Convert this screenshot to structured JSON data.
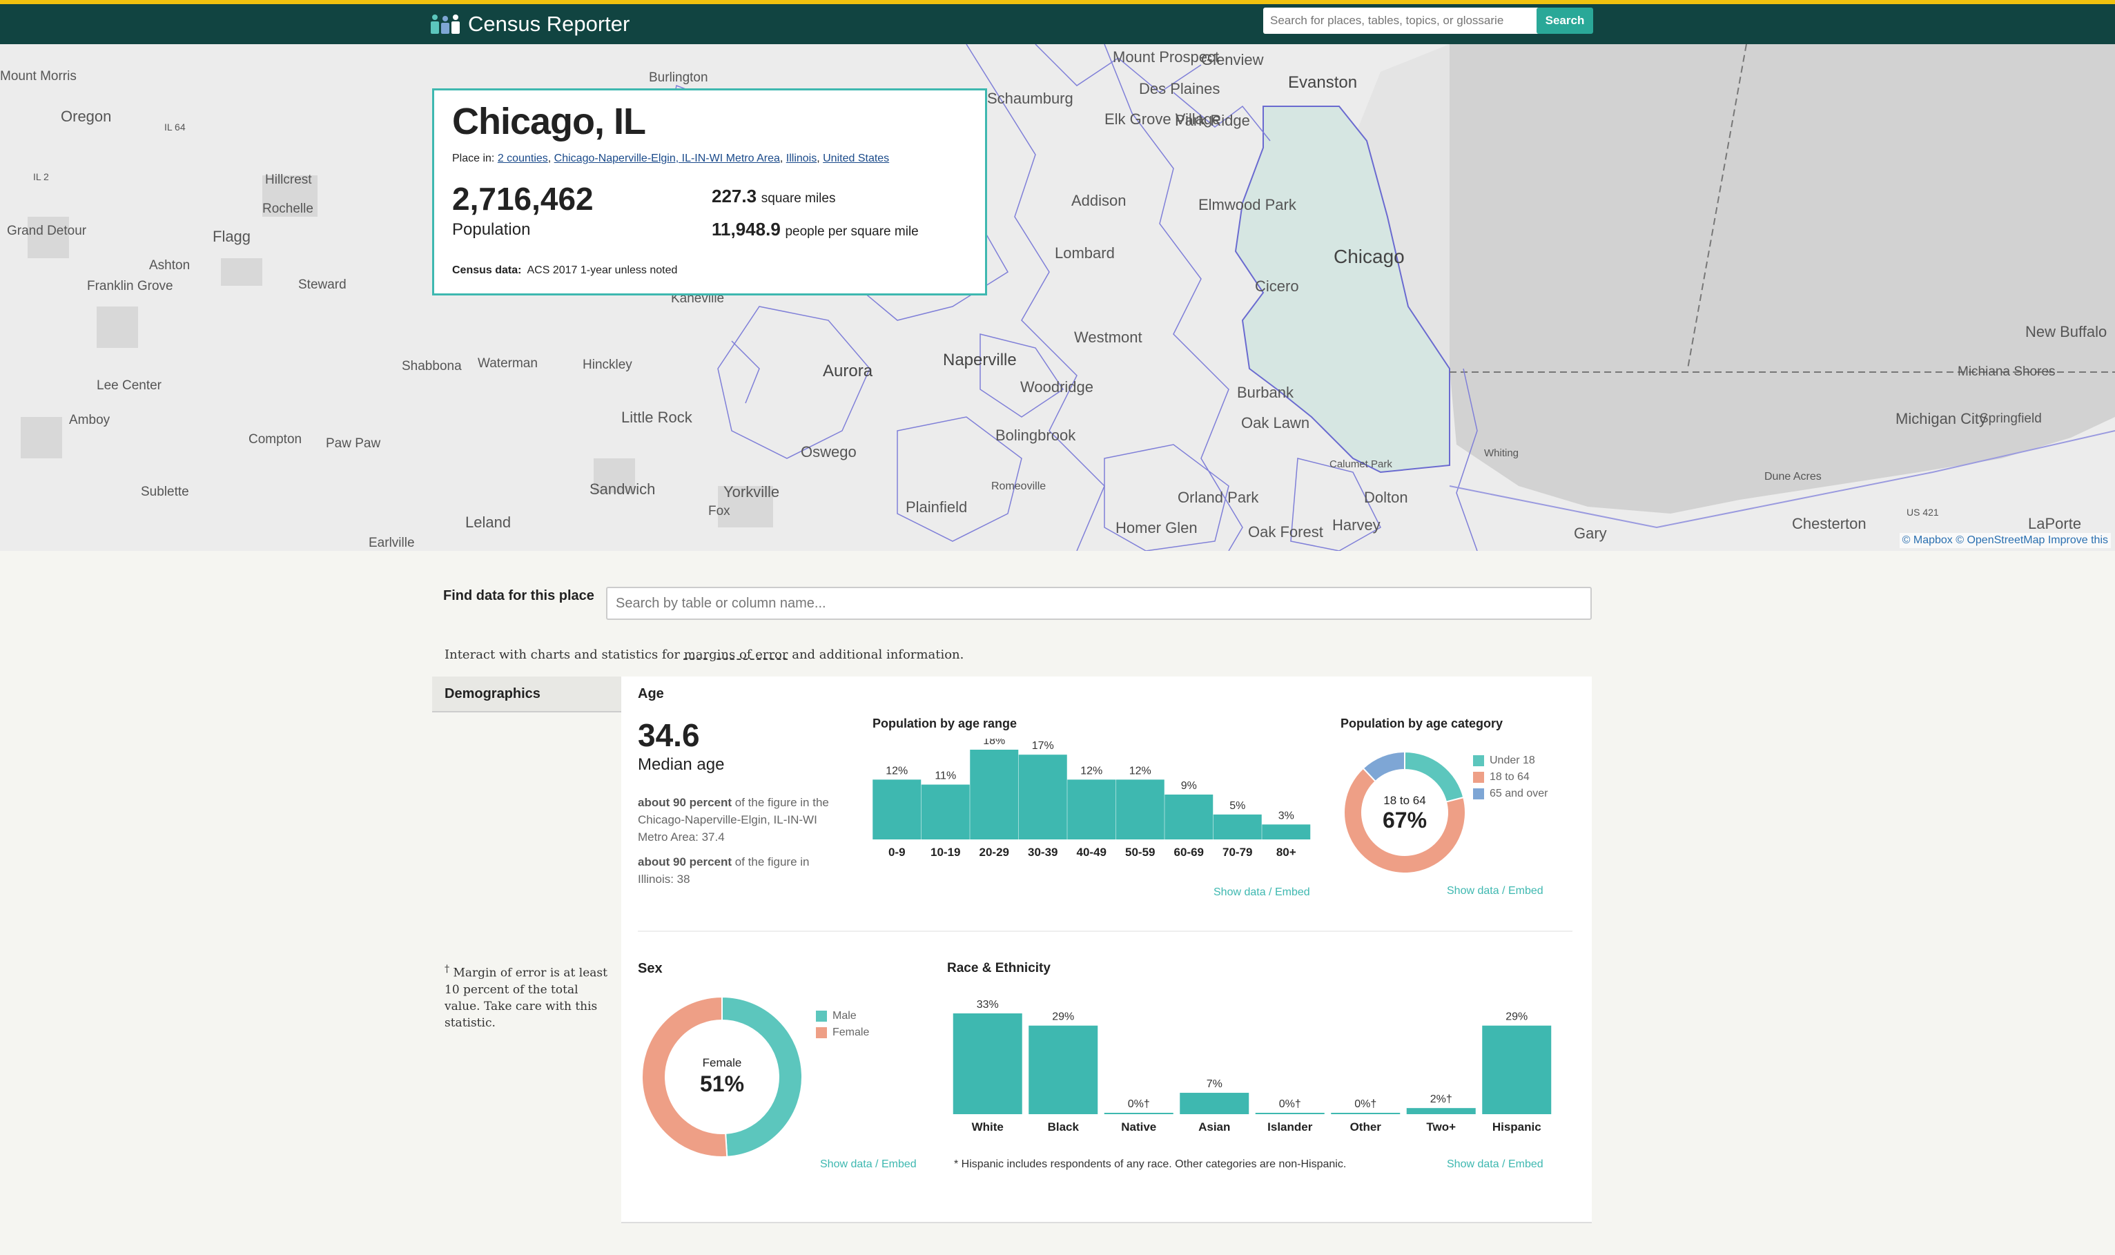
{
  "header": {
    "app_name": "Census Reporter",
    "search_placeholder": "Search for places, tables, topics, or glossarie",
    "search_button": "Search"
  },
  "map": {
    "labels": [
      "Mount Prospect",
      "Glenview",
      "Evanston",
      "Des Plaines",
      "Schaumburg",
      "Burlington",
      "Elk Grove Village",
      "Park Ridge",
      "Oregon",
      "IL 64",
      "IL 2",
      "Hillcrest",
      "Rochelle",
      "Grand Detour",
      "Flagg",
      "Ashton",
      "Steward",
      "Franklin Grove",
      "Addison",
      "Elmwood Park",
      "Chicago",
      "Lombard",
      "Cicero",
      "Kaneville",
      "Westmont",
      "New Buffalo",
      "Shabbona",
      "Waterman",
      "Hinckley",
      "Aurora",
      "Naperville",
      "Woodridge",
      "Michiana Shores",
      "Lee Center",
      "Amboy",
      "Little Rock",
      "Burbank",
      "Oak Lawn",
      "Michigan City",
      "Springfield",
      "Compton",
      "Paw Paw",
      "Oswego",
      "Bolingbrook",
      "Whiting",
      "Calumet Park",
      "Sublette",
      "Sandwich",
      "Yorkville",
      "Romeoville",
      "Orland Park",
      "Dolton",
      "Dune Acres",
      "Plainfield",
      "Fox",
      "Homer Glen",
      "Leland",
      "Harvey",
      "Oak Forest",
      "Chesterton",
      "US 421",
      "LaPorte",
      "Gary",
      "Earlville",
      "Mount Morris"
    ],
    "attribution": "© Mapbox © OpenStreetMap Improve this"
  },
  "place": {
    "name": "Chicago, IL",
    "place_in_label": "Place in:",
    "place_in": [
      "2 counties",
      "Chicago-Naperville-Elgin, IL-IN-WI Metro Area",
      "Illinois",
      "United States"
    ],
    "population": "2,716,462",
    "population_label": "Population",
    "area": "227.3",
    "area_label": "square miles",
    "density": "11,948.9",
    "density_label": "people per square mile",
    "census_label": "Census data:",
    "census_value": "ACS 2017 1-year unless noted"
  },
  "find": {
    "label": "Find data for this place",
    "placeholder": "Search by table or column name..."
  },
  "interact": {
    "prefix": "Interact with charts and statistics for ",
    "link": "margins of error",
    "suffix": " and additional information."
  },
  "sidebar": {
    "tab": "Demographics",
    "moe_mark": "†",
    "moe_note": "Margin of error is at least 10 percent of the total value. Take care with this statistic."
  },
  "age": {
    "title": "Age",
    "median": "34.6",
    "median_label": "Median age",
    "note1_bold": "about 90 percent",
    "note1": " of the figure in the Chicago-Naperville-Elgin, IL-IN-WI Metro Area: 37.4",
    "note2_bold": "about 90 percent",
    "note2": " of the figure in Illinois: 38",
    "range_title": "Population by age range",
    "category_title": "Population by age category",
    "donut_label": "18 to 64",
    "donut_value": "67%",
    "show_data": "Show data",
    "embed": "Embed"
  },
  "sex": {
    "title": "Sex",
    "donut_label": "Female",
    "donut_value": "51%"
  },
  "race": {
    "title": "Race & Ethnicity",
    "footnote": "* Hispanic includes respondents of any race. Other categories are non-Hispanic."
  },
  "chart_data": [
    {
      "type": "bar",
      "title": "Population by age range",
      "categories": [
        "0-9",
        "10-19",
        "20-29",
        "30-39",
        "40-49",
        "50-59",
        "60-69",
        "70-79",
        "80+"
      ],
      "values": [
        12,
        11,
        18,
        17,
        12,
        12,
        9,
        5,
        3
      ],
      "labels": [
        "12%",
        "11%",
        "18%",
        "17%",
        "12%",
        "12%",
        "9%",
        "5%",
        "3%"
      ],
      "color": "#3eb8b0"
    },
    {
      "type": "pie",
      "title": "Population by age category",
      "categories": [
        "Under 18",
        "18 to 64",
        "65 and over"
      ],
      "values": [
        21,
        67,
        12
      ],
      "colors": [
        "#5cc6bd",
        "#ee9f86",
        "#7ea6d5"
      ]
    },
    {
      "type": "pie",
      "title": "Sex",
      "categories": [
        "Male",
        "Female"
      ],
      "values": [
        49,
        51
      ],
      "colors": [
        "#5cc6bd",
        "#ee9f86"
      ]
    },
    {
      "type": "bar",
      "title": "Race & Ethnicity",
      "categories": [
        "White",
        "Black",
        "Native",
        "Asian",
        "Islander",
        "Other",
        "Two+",
        "Hispanic"
      ],
      "values": [
        33,
        29,
        0,
        7,
        0,
        0,
        2,
        29
      ],
      "labels": [
        "33%",
        "29%",
        "0%†",
        "7%",
        "0%†",
        "0%†",
        "2%†",
        "29%"
      ],
      "color": "#3eb8b0"
    }
  ]
}
